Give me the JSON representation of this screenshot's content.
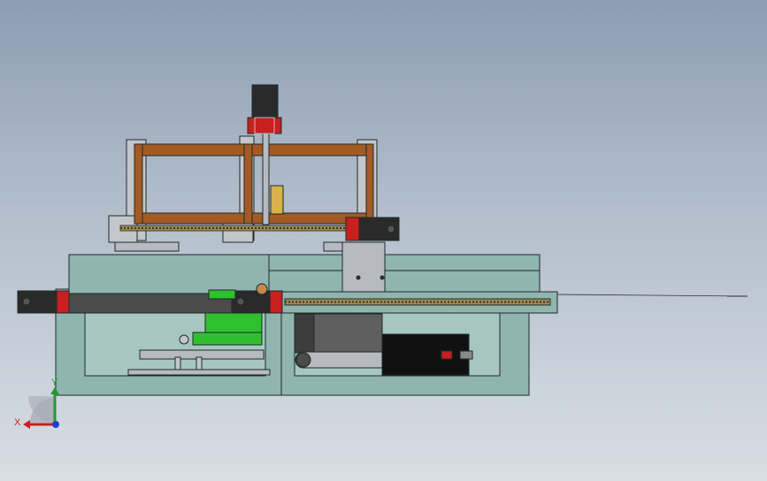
{
  "viewport": {
    "background_top": "#8d9eb3",
    "background_bottom": "#d9dee4"
  },
  "colors": {
    "frame_teal": "#8fb5ae",
    "frame_stroke": "#1e2a2a",
    "gantry_brown": "#a45a23",
    "gantry_grey": "#c3c7cc",
    "motor_black": "#2a2a2a",
    "coupler_red": "#c81f1f",
    "block_grey": "#b7bbc1",
    "rail_dark": "#4b4b4b",
    "screw_yellow": "#a18a52",
    "green_part": "#2fc02f",
    "panel_black": "#111111"
  },
  "triad": {
    "x_label": "X",
    "y_label": "Y",
    "x_color": "#c81f1f",
    "y_color": "#1f9a2b",
    "z_color": "#1f3fc8",
    "icon": "axis-triad-icon"
  }
}
